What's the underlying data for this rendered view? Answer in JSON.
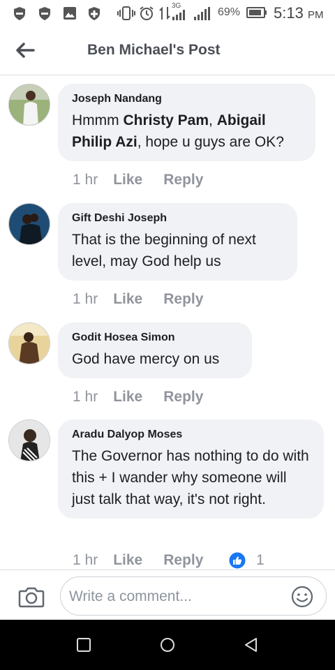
{
  "status_bar": {
    "battery_percent": "69%",
    "time": "5:13",
    "ampm": "PM",
    "network": "3G",
    "icons": [
      "shield-icon",
      "shield-icon",
      "image-icon",
      "plus-shield-icon",
      "vibrate-icon",
      "alarm-icon",
      "data-transfer-icon",
      "signal-icon",
      "signal-icon",
      "battery-icon"
    ]
  },
  "header": {
    "title": "Ben Michael's Post",
    "back_icon": "arrow-left-icon"
  },
  "comments": [
    {
      "author": "Joseph Nandang",
      "text_prefix": "Hmmm ",
      "mention1": "Christy Pam",
      "text_mid": ", ",
      "mention2": "Abigail Philip Azi",
      "text_suffix": ", hope u guys are OK?",
      "time": "1 hr",
      "like": "Like",
      "reply": "Reply"
    },
    {
      "author": "Gift Deshi Joseph",
      "text": "That is the beginning of next level, may God help us",
      "time": "1 hr",
      "like": "Like",
      "reply": "Reply"
    },
    {
      "author": "Godit Hosea Simon",
      "text": "God have mercy on us",
      "time": "1 hr",
      "like": "Like",
      "reply": "Reply"
    },
    {
      "author": "Aradu Dalyop Moses",
      "text": "The Governor has nothing to do with this + I wander why someone will just talk that way, it's not right.",
      "time": "1 hr",
      "like": "Like",
      "reply": "Reply",
      "reaction_count": "1",
      "reaction_icon": "thumbs-up-icon"
    }
  ],
  "composer": {
    "placeholder": "Write a comment...",
    "camera_icon": "camera-icon",
    "emoji_icon": "emoji-icon"
  },
  "nav_bar": {
    "icons": [
      "recents-square-icon",
      "home-circle-icon",
      "back-triangle-icon"
    ]
  },
  "colors": {
    "bubble": "#f0f2f5",
    "meta_text": "#90949c",
    "like_blue": "#1877f2",
    "nav_bg": "#000000"
  }
}
